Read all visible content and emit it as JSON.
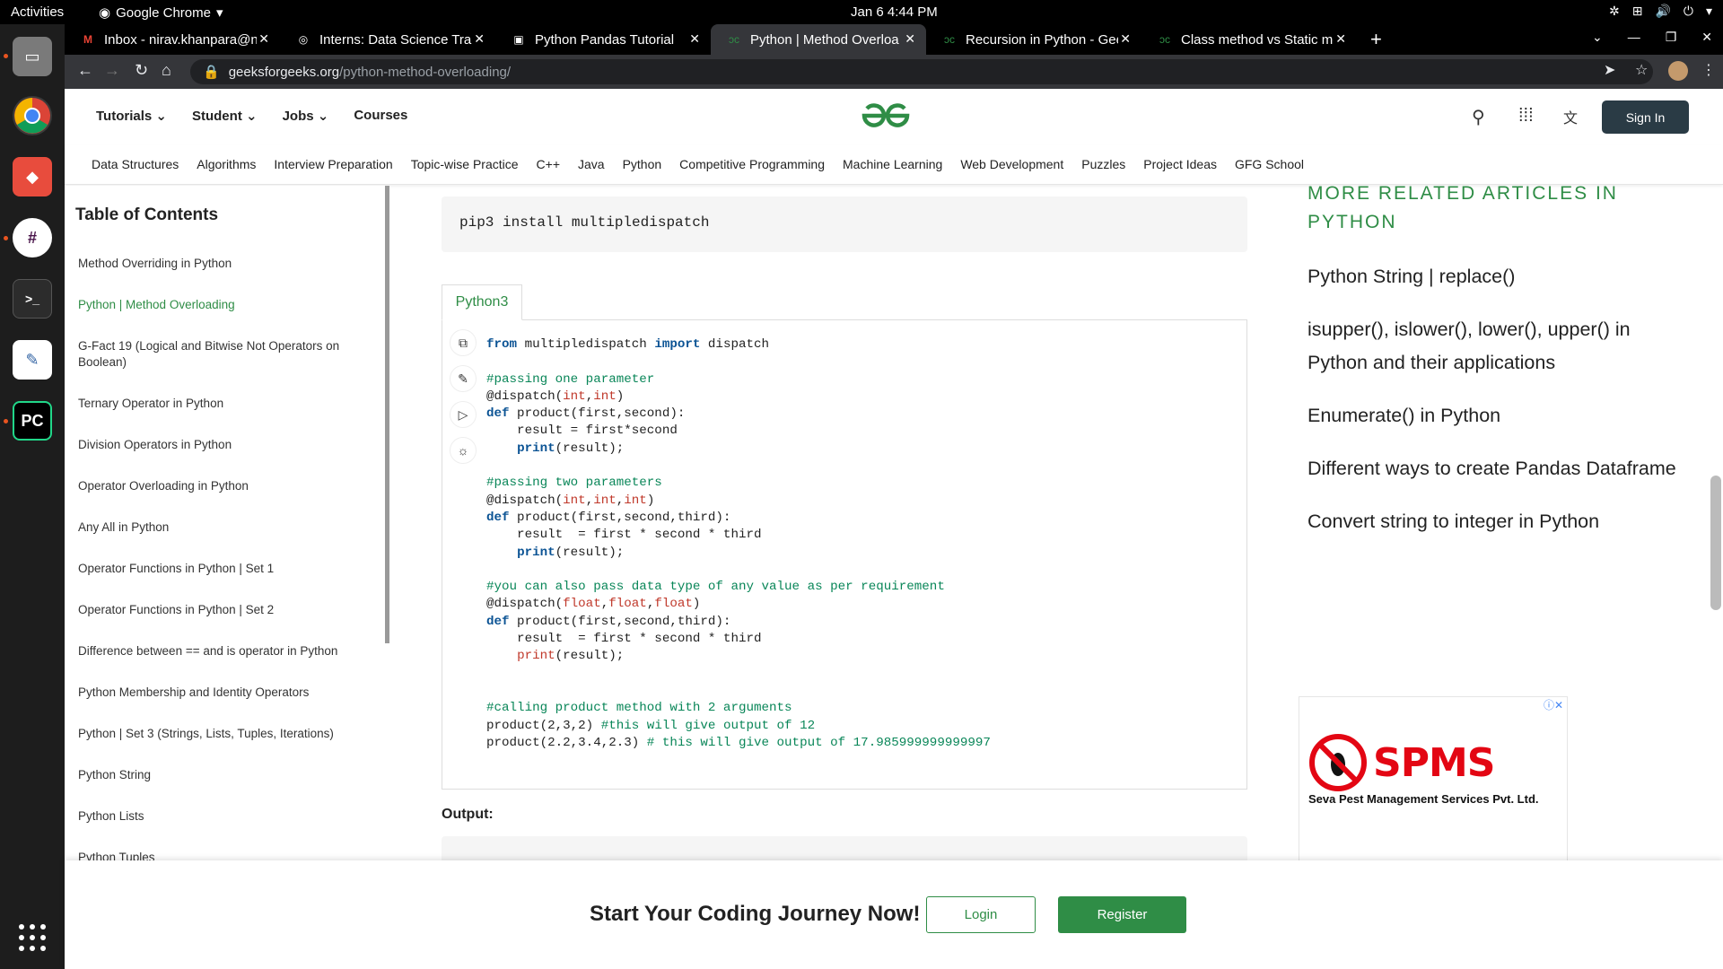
{
  "system_bar": {
    "activities": "Activities",
    "app": "Google Chrome",
    "clock": "Jan 6  4:44 PM"
  },
  "tabs": [
    {
      "title": "Inbox - nirav.khanpara@n",
      "icon": "gmail-icon"
    },
    {
      "title": "Interns: Data Science Trai",
      "icon": "globe-icon"
    },
    {
      "title": "Python Pandas Tutorial",
      "icon": "page-icon"
    },
    {
      "title": "Python | Method Overloa",
      "icon": "gfg-icon",
      "active": true
    },
    {
      "title": "Recursion in Python - Gee",
      "icon": "gfg-icon"
    },
    {
      "title": "Class method vs Static me",
      "icon": "gfg-icon"
    }
  ],
  "address": {
    "domain": "geeksforgeeks.org",
    "path": "/python-method-overloading/"
  },
  "header": {
    "menu": [
      "Tutorials",
      "Student",
      "Jobs",
      "Courses"
    ],
    "sign_in": "Sign In"
  },
  "subnav": [
    "Data Structures",
    "Algorithms",
    "Interview Preparation",
    "Topic-wise Practice",
    "C++",
    "Java",
    "Python",
    "Competitive Programming",
    "Machine Learning",
    "Web Development",
    "Puzzles",
    "Project Ideas",
    "GFG School"
  ],
  "toc": {
    "title": "Table of Contents",
    "items": [
      "Method Overriding in Python",
      "Python | Method Overloading",
      "G-Fact 19 (Logical and Bitwise Not Operators on Boolean)",
      "Ternary Operator in Python",
      "Division Operators in Python",
      "Operator Overloading in Python",
      "Any All in Python",
      "Operator Functions in Python | Set 1",
      "Operator Functions in Python | Set 2",
      "Difference between == and is operator in Python",
      "Python Membership and Identity Operators",
      "Python | Set 3 (Strings, Lists, Tuples, Iterations)",
      "Python String",
      "Python Lists",
      "Python Tuples"
    ],
    "active_index": 1
  },
  "content": {
    "pip_command": "pip3 install multipledispatch",
    "lang_tab": "Python3",
    "output_label": "Output:"
  },
  "related": {
    "title": "MORE RELATED ARTICLES IN PYTHON",
    "items": [
      "Python String | replace()",
      "isupper(), islower(), lower(), upper() in Python and their applications",
      "Enumerate() in Python",
      "Different ways to create Pandas Dataframe",
      "Convert string to integer in Python"
    ]
  },
  "ad": {
    "brand": "SPMS",
    "subtitle": "Seva Pest Management Services Pvt. Ltd."
  },
  "footer_cta": {
    "text": "Start Your Coding Journey Now!",
    "login": "Login",
    "register": "Register"
  },
  "colors": {
    "accent": "#2f8d46",
    "dark_button": "#2a3b45"
  }
}
